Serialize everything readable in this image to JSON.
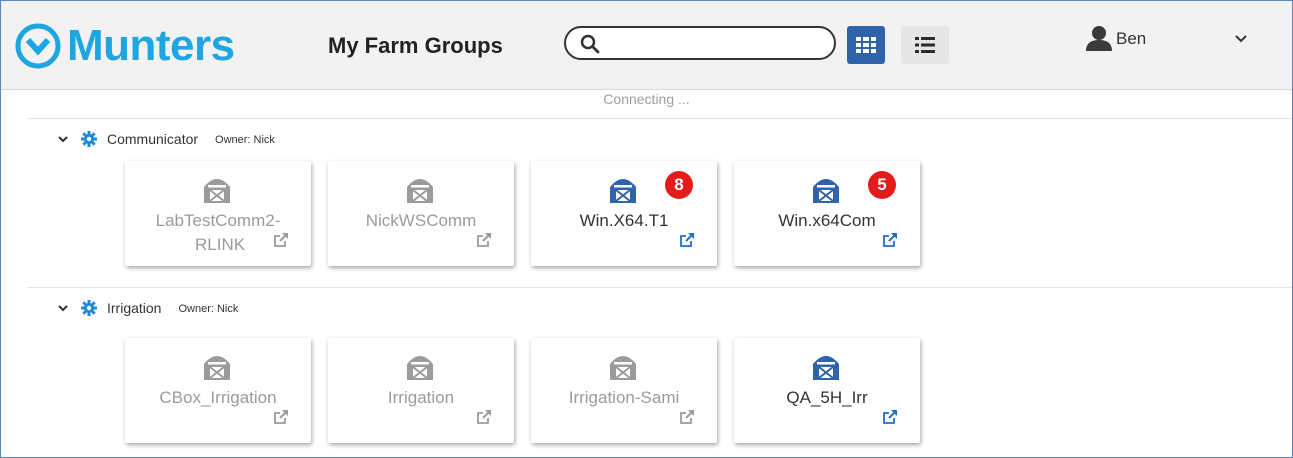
{
  "app": {
    "brand": "Munters",
    "brand_color": "#1ea6e3"
  },
  "header": {
    "title": "My Farm Groups",
    "search": {
      "placeholder": "",
      "value": ""
    },
    "view_modes": [
      "grid-view",
      "list-view"
    ],
    "active_view": "grid-view",
    "user": {
      "name": "Ben"
    }
  },
  "status_text": "Connecting ...",
  "colors": {
    "online": "#2f64aa",
    "offline": "#9b9b9b",
    "badge": "#e31b1b",
    "accent": "#1e88d9"
  },
  "groups": [
    {
      "name": "Communicator",
      "owner": "Owner: Nick",
      "farms": [
        {
          "name_line1": "LabTestComm2-",
          "name_line2": "RLINK",
          "online": false
        },
        {
          "name_line1": "NickWSComm",
          "online": false
        },
        {
          "name_line1": "Win.X64.T1",
          "online": true,
          "alarms": "8"
        },
        {
          "name_line1": "Win.x64Com",
          "online": true,
          "alarms": "5"
        }
      ]
    },
    {
      "name": "Irrigation",
      "owner": "Owner: Nick",
      "farms": [
        {
          "name_line1": "CBox_Irrigation",
          "online": false
        },
        {
          "name_line1": "Irrigation",
          "online": false
        },
        {
          "name_line1": "Irrigation-Sami",
          "online": false
        },
        {
          "name_line1": "QA_5H_Irr",
          "online": true
        }
      ]
    }
  ]
}
